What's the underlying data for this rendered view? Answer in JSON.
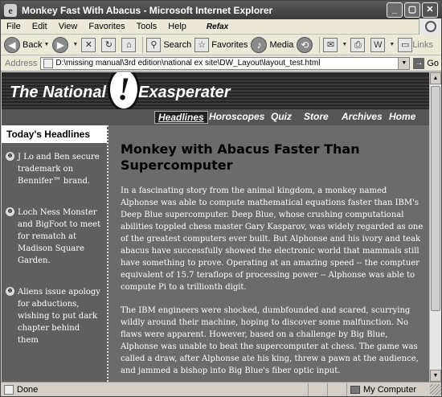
{
  "window": {
    "title": "Monkey Fast With Abacus - Microsoft Internet Explorer",
    "icon": "ie-page-icon",
    "controls": [
      "_",
      "▢",
      "✕"
    ]
  },
  "menubar": {
    "items": [
      "File",
      "Edit",
      "View",
      "Favorites",
      "Tools",
      "Help"
    ],
    "extra": "Refax"
  },
  "toolbar": {
    "back_label": "Back",
    "search_label": "Search",
    "favorites_label": "Favorites",
    "media_label": "Media",
    "links_label": "Links"
  },
  "addressbar": {
    "label": "Address",
    "url": "D:\\missing manual\\3rd edition\\national ex site\\DW_Layout\\layout_test.html",
    "go_label": "Go"
  },
  "site": {
    "title_left": "The National",
    "title_mark": "!",
    "title_right": "Exasperater",
    "nav": [
      "Headlines",
      "Horoscopes",
      "Quiz",
      "Store",
      "Archives",
      "Home"
    ],
    "active_nav": "Headlines"
  },
  "sidebar": {
    "heading": "Today's Headlines",
    "items": [
      "J Lo and Ben secure trademark on Bennifer™ brand.",
      "Loch Ness Monster and BigFoot to meet for rematch at Madison Square Garden.",
      "Aliens issue apology for abductions, wishing to put dark chapter behind them"
    ]
  },
  "article": {
    "headline": "Monkey with Abacus Faster Than Supercomputer",
    "paragraphs": [
      "In a fascinating story from the animal kingdom, a monkey named Alphonse was able to compute mathematical equations faster than IBM's Deep Blue supercomputer. Deep Blue, whose crushing computational abilities toppled chess master Gary Kasparov, was widely regarded as one of the greatest computers ever  built.  But Alphonse and his ivory and teak abacus have successfully showed the electronic world that mammals still have something to prove. Operating at an amazing speed -- the comptuer equivalent of 15.7 teraflops of processing power -- Alphonse was able to compute Pi to a trillionth digit.",
      "The IBM engineers were shocked, dumbfounded and scared, scurrying wildly around their machine, hoping to discover some malfunction. No flaws were apparent. However, based on a challenge by Big Blue, Alphonse was unable to beat the supercomputer at chess. The game was called a draw, after Alphonse ate his king, threw a pawn at the audience, and jammed a bishop into Big Blue's fiber optic input."
    ]
  },
  "statusbar": {
    "status": "Done",
    "zone": "My Computer"
  }
}
